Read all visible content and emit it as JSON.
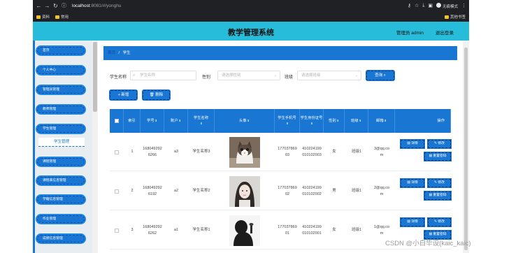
{
  "browser": {
    "url_host": "localhost",
    "url_rest": ":8081/#/yonghu",
    "incognito_label": "无痕模式",
    "bookmarks": [
      "资料",
      "常用"
    ],
    "bookmark_right": "其他书签"
  },
  "header": {
    "title": "教学管理系统",
    "user": "管理员 admin",
    "logout": "退出登录"
  },
  "sidebar": {
    "items": [
      "首页",
      "个人中心",
      "管理员管理",
      "教师管理",
      "学生管理",
      "课程管理",
      "课程表信息管理",
      "学籍信息管理",
      "作业管理",
      "成绩信息管理"
    ],
    "active_sub": "学生管理"
  },
  "breadcrumb": {
    "home": "首页",
    "sep": "/",
    "current": "学生"
  },
  "search": {
    "name_label": "学生名称",
    "name_placeholder": "学生名称",
    "gender_label": "性别",
    "gender_placeholder": "请选择性别",
    "class_label": "班级",
    "class_placeholder": "请选择班级",
    "query_button": "查询"
  },
  "actions": {
    "add": "新增",
    "delete": "删除"
  },
  "table": {
    "headers": {
      "index": "索引",
      "student_no": "学号",
      "account": "账户",
      "name": "学生名称",
      "avatar": "头像",
      "phone": "学生手机号",
      "id_card": "学生身份证号",
      "gender": "性别",
      "class": "班级",
      "email": "邮箱",
      "ops": "操作"
    },
    "rows": [
      {
        "index": "1",
        "student_no": "1680492926266",
        "account": "a3",
        "name": "学生名称3",
        "phone": "17703786903",
        "id_card": "410224199010102003",
        "gender": "女",
        "class": "班级1",
        "email": "3@qq.com"
      },
      {
        "index": "2",
        "student_no": "1680492926192",
        "account": "a2",
        "name": "学生名称2",
        "phone": "17703786902",
        "id_card": "410224199010102002",
        "gender": "男",
        "class": "班级1",
        "email": "2@qq.com"
      },
      {
        "index": "3",
        "student_no": "1680492926262",
        "account": "a1",
        "name": "学生名称1",
        "phone": "17703786901",
        "id_card": "410224199010102001",
        "gender": "女",
        "class": "班级1",
        "email": "1@qq.com"
      }
    ],
    "row_buttons": {
      "detail": "详情",
      "edit": "修改",
      "reset": "重置密码"
    }
  },
  "watermark": "CSDN @小白毕设(kaic_kaic)",
  "colors": {
    "header_bg": "#27bcd9",
    "primary": "#1976d2"
  }
}
